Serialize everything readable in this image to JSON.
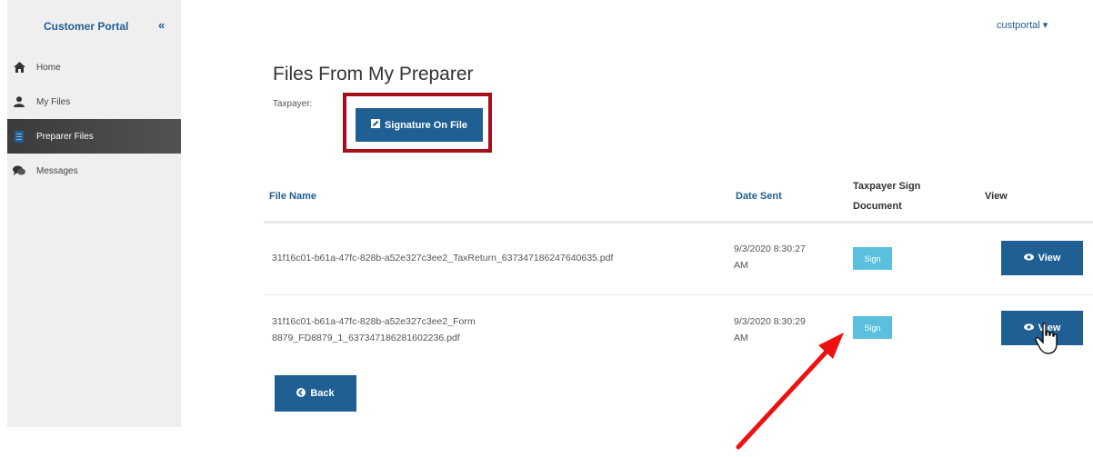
{
  "sidebar": {
    "brand": "Customer Portal",
    "collapse_label": "«",
    "items": [
      {
        "label": "Home",
        "icon": "home-icon"
      },
      {
        "label": "My Files",
        "icon": "user-icon"
      },
      {
        "label": "Preparer Files",
        "icon": "document-icon",
        "active": true
      },
      {
        "label": "Messages",
        "icon": "comments-icon"
      }
    ]
  },
  "header": {
    "user": "custportal ▾"
  },
  "main": {
    "title": "Files From My Preparer",
    "taxpayer_label": "Taxpayer:",
    "signature_button": "Signature On File",
    "table": {
      "headers": {
        "file_name": "File Name",
        "date_sent": "Date Sent",
        "sign_line1": "Taxpayer Sign",
        "sign_line2": "Document",
        "view": "View"
      },
      "rows": [
        {
          "file_line1": "31f16c01-b61a-47fc-828b-a52e327c3ee2_TaxReturn_637347186247640635.pdf",
          "file_line2": "",
          "date_line1": "9/3/2020 8:30:27",
          "date_line2": "AM",
          "sign": "Sign",
          "view": "View"
        },
        {
          "file_line1": "31f16c01-b61a-47fc-828b-a52e327c3ee2_Form",
          "file_line2": "8879_FD8879_1_637347186281602236.pdf",
          "date_line1": "9/3/2020 8:30:29",
          "date_line2": "AM",
          "sign": "Sign",
          "view": "View"
        }
      ]
    },
    "back_button": "Back"
  },
  "colors": {
    "primary": "#1f5f93",
    "sign_button": "#5bc0de",
    "highlight_box": "#a50f1a",
    "annotation_arrow": "#ee1111"
  }
}
